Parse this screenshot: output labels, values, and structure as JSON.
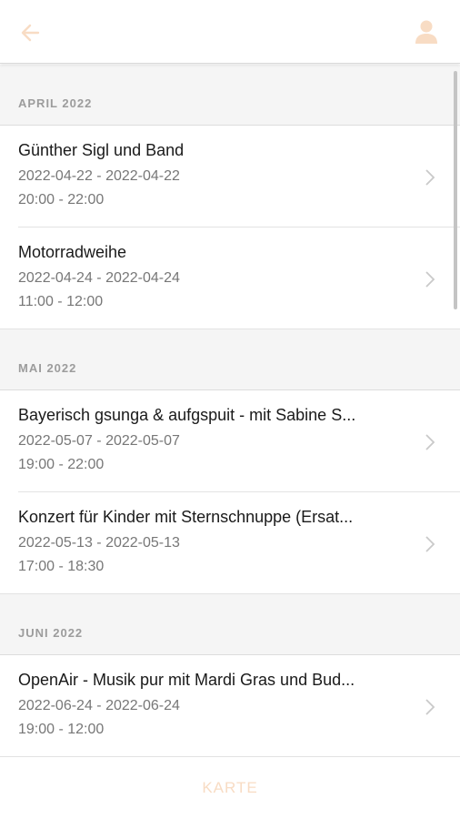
{
  "colors": {
    "accent": "#f8dcc4",
    "section_text": "#9c9c9c",
    "secondary_text": "#777777"
  },
  "header": {
    "back_icon": "arrow-left-icon",
    "profile_icon": "user-icon"
  },
  "sections": [
    {
      "title": "APRIL 2022",
      "events": [
        {
          "title": "Günther Sigl und Band",
          "dates": "2022-04-22 - 2022-04-22",
          "time": "20:00 - 22:00"
        },
        {
          "title": "Motorradweihe",
          "dates": "2022-04-24 - 2022-04-24",
          "time": "11:00 - 12:00"
        }
      ]
    },
    {
      "title": "MAI 2022",
      "events": [
        {
          "title": "Bayerisch gsunga & aufgspuit - mit Sabine S...",
          "dates": "2022-05-07 - 2022-05-07",
          "time": "19:00 - 22:00"
        },
        {
          "title": "Konzert für Kinder mit Sternschnuppe (Ersat...",
          "dates": "2022-05-13 - 2022-05-13",
          "time": "17:00 - 18:30"
        }
      ]
    },
    {
      "title": "JUNI 2022",
      "events": [
        {
          "title": "OpenAir - Musik pur mit Mardi Gras und Bud...",
          "dates": "2022-06-24 - 2022-06-24",
          "time": "19:00 - 12:00"
        }
      ]
    }
  ],
  "footer": {
    "map_label": "KARTE"
  }
}
